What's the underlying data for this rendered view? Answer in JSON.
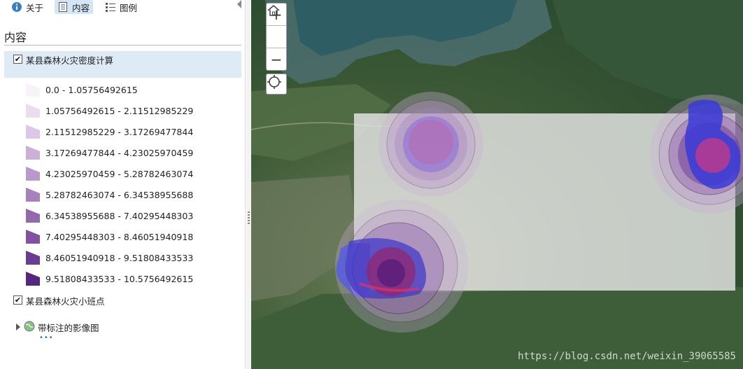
{
  "toolbar": {
    "about_label": "关于",
    "content_label": "内容",
    "legend_label": "图例"
  },
  "panel": {
    "title": "内容",
    "layers": [
      {
        "label": "某县森林火灾密度计算",
        "checked": true
      },
      {
        "label": "某县森林火灾小班点",
        "checked": true
      },
      {
        "label": "带标注的影像图"
      }
    ],
    "legend": [
      {
        "label": "0.0 - 1.05756492615",
        "color": "#f7f3f9"
      },
      {
        "label": "1.05756492615 - 2.11512985229",
        "color": "#ebdcef"
      },
      {
        "label": "2.11512985229 - 3.17269477844",
        "color": "#dcc7e4"
      },
      {
        "label": "3.17269477844 - 4.23025970459",
        "color": "#cbb0d8"
      },
      {
        "label": "4.23025970459 - 5.28782463074",
        "color": "#b998cb"
      },
      {
        "label": "5.28782463074 - 6.34538955688",
        "color": "#a780bd"
      },
      {
        "label": "6.34538955688 - 7.40295448303",
        "color": "#9468af"
      },
      {
        "label": "7.40295448303 - 8.46051940918",
        "color": "#8052a1"
      },
      {
        "label": "8.46051940918 - 9.51808433533",
        "color": "#6b3c92"
      },
      {
        "label": "9.51808433533 - 10.5756492615",
        "color": "#552782"
      }
    ]
  },
  "map": {
    "zoom_in": "+",
    "zoom_out": "−",
    "watermark": "https://blog.csdn.net/weixin_39065585"
  },
  "colors": {
    "accent": "#d4e6f5",
    "selected_layer_bg": "#deebf7",
    "density_hot": "#e0306a",
    "density_blue": "#2b3ee0"
  }
}
